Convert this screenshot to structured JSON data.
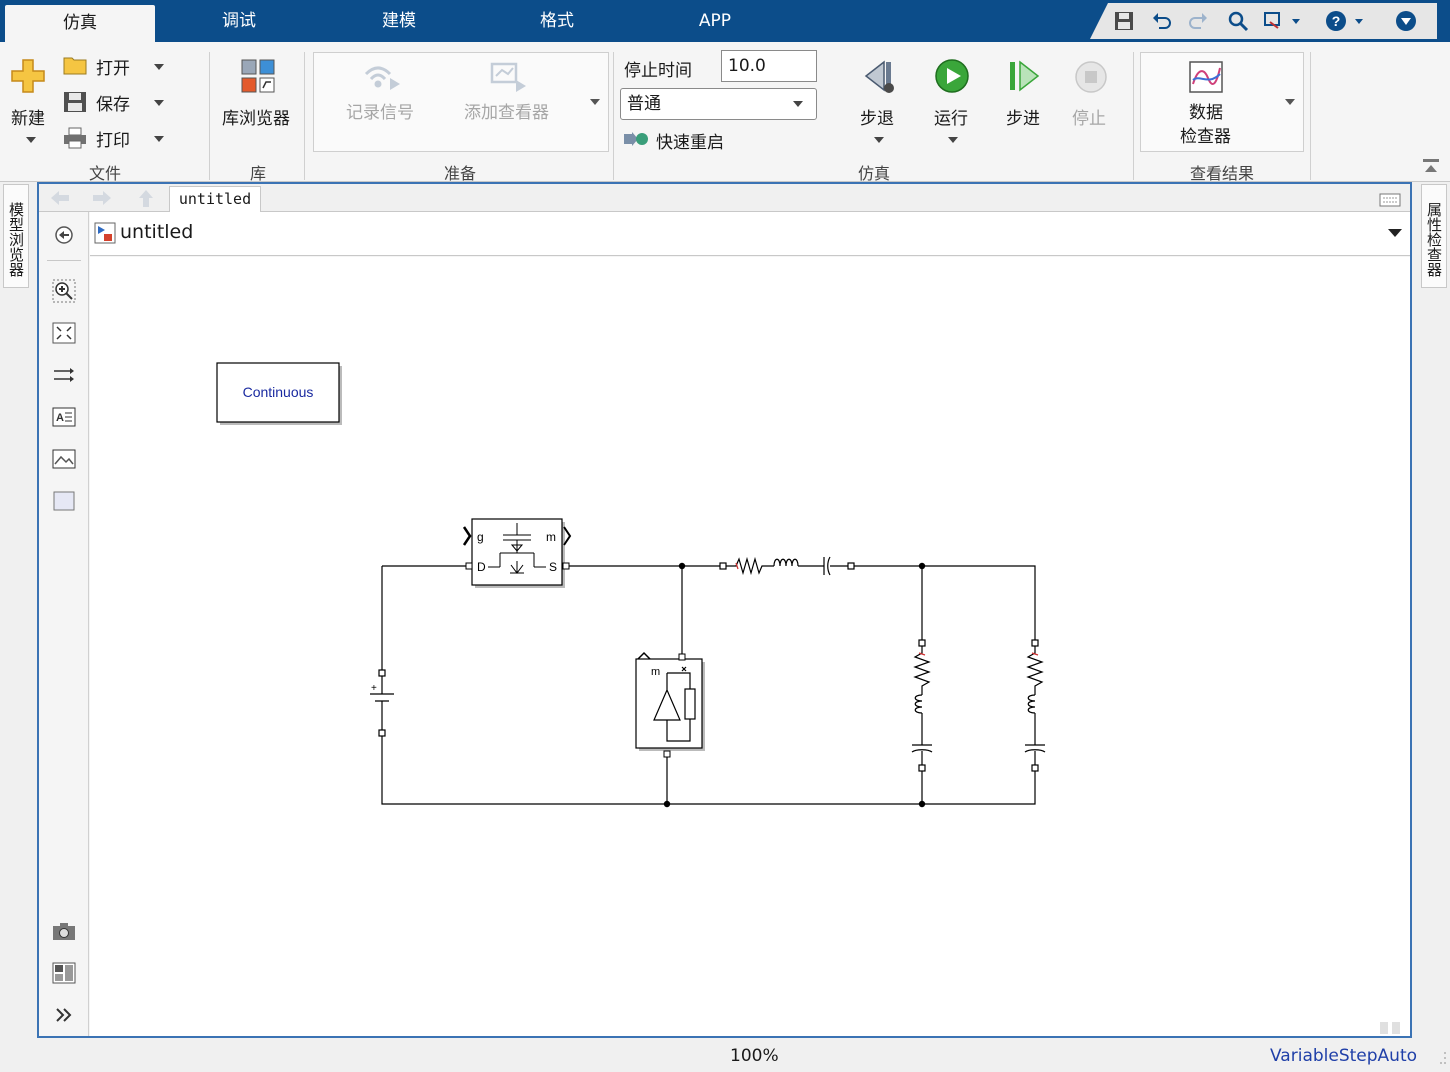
{
  "tabs": [
    "仿真",
    "调试",
    "建模",
    "格式",
    "APP"
  ],
  "ribbon": {
    "file": {
      "new": "新建",
      "open": "打开",
      "save": "保存",
      "print": "打印",
      "group": "文件"
    },
    "library": {
      "browser": "库浏览器",
      "group": "库"
    },
    "prepare": {
      "log_signals": "记录信号",
      "add_viewer": "添加查看器",
      "group": "准备"
    },
    "simulate": {
      "stop_time_label": "停止时间",
      "stop_time_value": "10.0",
      "mode": "普通",
      "fast_restart": "快速重启",
      "step_back": "步退",
      "run": "运行",
      "step_forward": "步进",
      "stop": "停止",
      "group": "仿真"
    },
    "review": {
      "inspector_line1": "数据",
      "inspector_line2": "检查器",
      "group": "查看结果"
    }
  },
  "side_panels": {
    "left": "模型浏览器",
    "right": "属性检查器"
  },
  "editor": {
    "doc_tab": "untitled",
    "breadcrumb": "untitled"
  },
  "diagram": {
    "powergui_label": "Continuous",
    "mosfet_ports": {
      "g": "g",
      "m": "m",
      "d": "D",
      "s": "S"
    },
    "diode_ports": {
      "m": "m"
    }
  },
  "status": {
    "zoom": "100%",
    "solver": "VariableStepAuto"
  },
  "colors": {
    "tabbar": "#0c4d8a",
    "frame": "#3b73b4",
    "solver_text": "#1f3fa8",
    "run_green": "#3aa63a"
  }
}
